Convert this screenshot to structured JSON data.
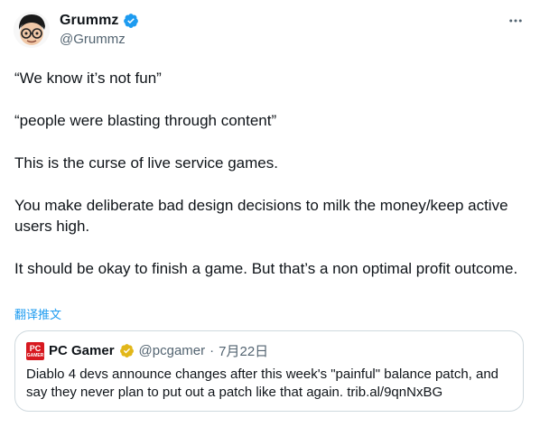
{
  "author": {
    "name": "Grummz",
    "handle": "@Grummz"
  },
  "tweet": {
    "paragraphs": [
      "“We know it’s not fun”",
      "“people were blasting through content”",
      "This is the curse of live service games.",
      "You make deliberate bad design decisions to milk the money/keep active users high.",
      "It should be okay to finish a game. But that’s a non optimal profit outcome."
    ],
    "translate_label": "翻译推文"
  },
  "quote": {
    "logo_text_top": "PC",
    "logo_text_bottom": "GAMER",
    "name": "PC Gamer",
    "handle": "@pcgamer",
    "separator": "·",
    "date": "7月22日",
    "text": "Diablo 4 devs announce changes after this week's \"painful\" balance patch, and say they never plan to put out a patch like that again. trib.al/9qnNxBG"
  },
  "icons": {
    "verified": "verified-badge-icon",
    "more": "more-options-icon"
  },
  "colors": {
    "verified_blue": "#1d9bf0",
    "verified_gold": "#e2b719",
    "link": "#1d9bf0",
    "secondary_text": "#536471",
    "border": "#cfd9de",
    "pcgamer_red": "#d71920"
  }
}
